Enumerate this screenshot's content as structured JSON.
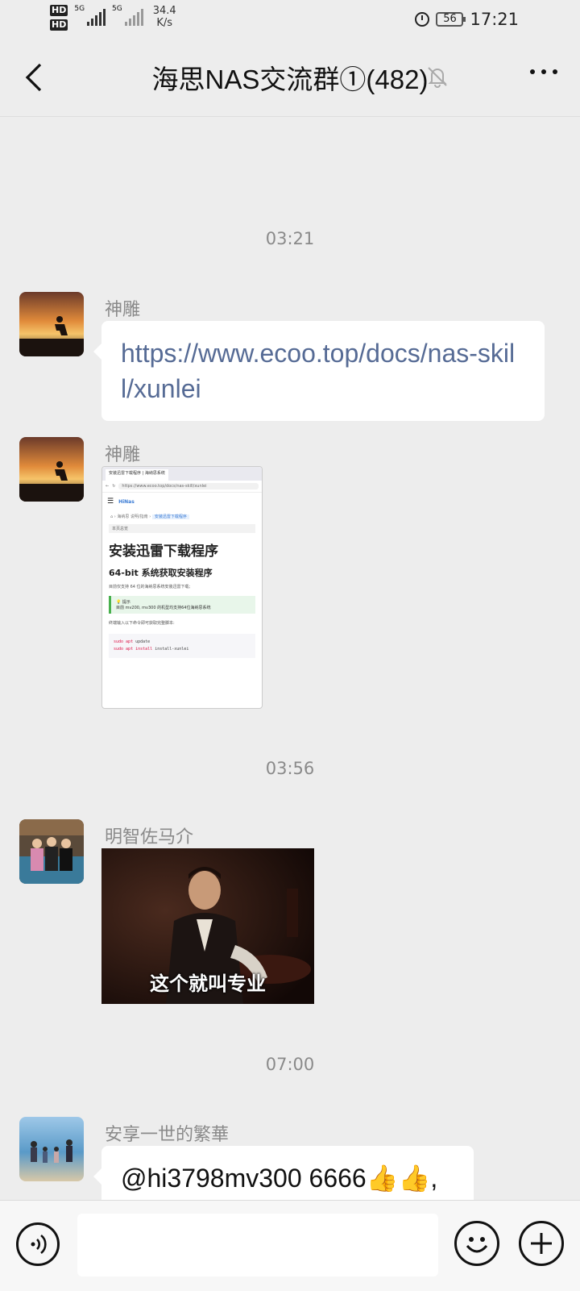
{
  "status_bar": {
    "hd1": "HD",
    "hd2": "HD",
    "sig1_label": "5G",
    "sig2_label": "5G",
    "speed_value": "34.4",
    "speed_unit": "K/s",
    "battery": "56",
    "time": "17:21"
  },
  "header": {
    "title": "海思NAS交流群①(482)",
    "muted": true
  },
  "messages": [
    {
      "time": "03:21",
      "sender": "神雕",
      "text": "https://www.ecoo.top/docs/nas-skill/xunlei"
    },
    {
      "sender": "神雕",
      "image": {
        "tab_label": "安装迅雷下载程序 | 海纳思系统",
        "url": "https://www.ecoo.top/docs/nas-skill/xunlei",
        "logo": "HiNas",
        "bread_home": "海纳思 说明/指南",
        "bread_current": "安装迅雷下载程序",
        "tag": "本页总览",
        "h1": "安装迅雷下载程序",
        "h2": "64-bit 系统获取安装程序",
        "p1": "目前仅支持 64 位的海纳思系统安装迅雷下载;",
        "tip_title": "提示",
        "tip_text": "目前 mv200, mv300 的机型均支持64位海纳思系统",
        "p2": "终端输入以下命令即可获取完整脚本:",
        "code1_kw": "sudo apt",
        "code1_rest": "update",
        "code2_kw": "sudo apt install",
        "code2_rest": "install-xunlei"
      }
    },
    {
      "time": "03:56",
      "sender": "明智佐马介",
      "gif_caption": "这个就叫专业"
    },
    {
      "time": "07:00",
      "sender": "安享一世的繁華",
      "text": "@hi3798mv300 6666👍👍,"
    }
  ],
  "input": {
    "placeholder": ""
  },
  "colors": {
    "background": "#ededed",
    "link": "#566b95",
    "bubble": "#ffffff"
  },
  "icons": [
    "back-icon",
    "mute-bell-icon",
    "more-icon",
    "voice-icon",
    "emoji-icon",
    "plus-icon",
    "alarm-icon",
    "battery-icon",
    "signal-icon"
  ]
}
